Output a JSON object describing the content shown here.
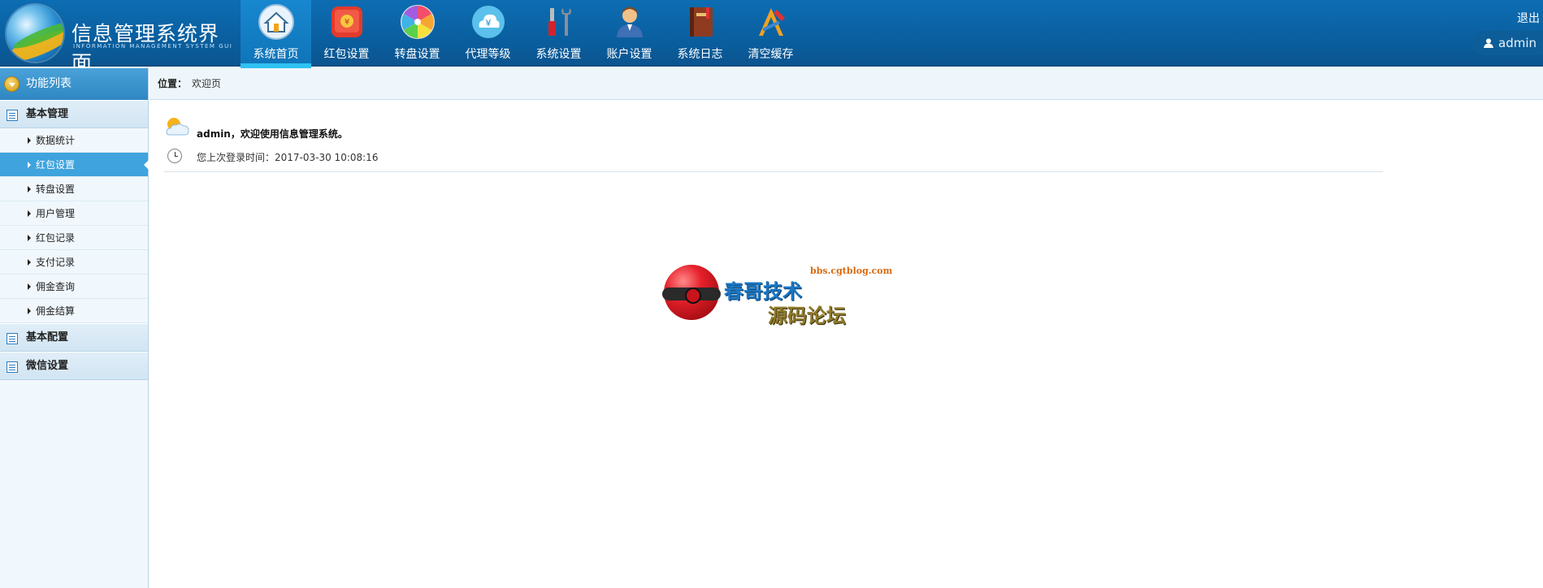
{
  "header": {
    "title": "信息管理系统界面",
    "subtitle": "INFORMATION MANAGEMENT SYSTEM GUI",
    "logout_label": "退出",
    "user": "admin"
  },
  "nav": [
    {
      "label": "系统首页",
      "icon": "home-icon",
      "active": true
    },
    {
      "label": "红包设置",
      "icon": "red-envelope-icon",
      "active": false
    },
    {
      "label": "转盘设置",
      "icon": "wheel-icon",
      "active": false
    },
    {
      "label": "代理等级",
      "icon": "yen-cloud-icon",
      "active": false
    },
    {
      "label": "系统设置",
      "icon": "tools-icon",
      "active": false
    },
    {
      "label": "账户设置",
      "icon": "user-icon",
      "active": false
    },
    {
      "label": "系统日志",
      "icon": "book-icon",
      "active": false
    },
    {
      "label": "清空缓存",
      "icon": "clean-icon",
      "active": false
    }
  ],
  "sidebar": {
    "title": "功能列表",
    "groups": [
      {
        "label": "基本管理",
        "items": [
          {
            "label": "数据统计",
            "active": false
          },
          {
            "label": "红包设置",
            "active": true
          },
          {
            "label": "转盘设置",
            "active": false
          },
          {
            "label": "用户管理",
            "active": false
          },
          {
            "label": "红包记录",
            "active": false
          },
          {
            "label": "支付记录",
            "active": false
          },
          {
            "label": "佣金查询",
            "active": false
          },
          {
            "label": "佣金结算",
            "active": false
          }
        ]
      },
      {
        "label": "基本配置",
        "items": []
      },
      {
        "label": "微信设置",
        "items": []
      }
    ]
  },
  "breadcrumb": {
    "label": "位置：",
    "current": "欢迎页"
  },
  "welcome": {
    "message": "admin，欢迎使用信息管理系统。",
    "last_login": "您上次登录时间：2017-03-30 10:08:16"
  },
  "watermark": {
    "url": "bbs.cgtblog.com",
    "line1": "春哥技术",
    "line2": "源码论坛"
  },
  "colors": {
    "header_bg": "#0b63a6",
    "active_tab": "#1787cf",
    "sidebar_active": "#3fa3dd"
  }
}
